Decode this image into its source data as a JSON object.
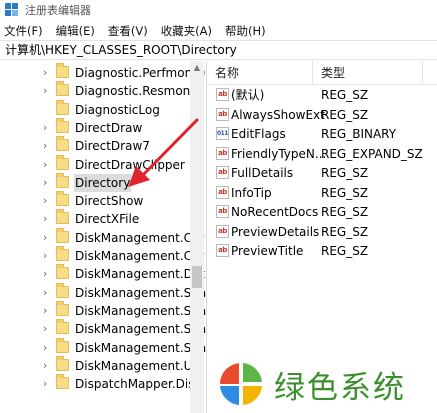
{
  "window": {
    "title": "注册表编辑器"
  },
  "menu": [
    "文件(F)",
    "编辑(E)",
    "查看(V)",
    "收藏夹(A)",
    "帮助(H)"
  ],
  "address": "计算机\\HKEY_CLASSES_ROOT\\Directory",
  "tree": {
    "items": [
      {
        "label": "Diagnostic.Perfmon.D",
        "expandable": true,
        "selected": false
      },
      {
        "label": "Diagnostic.Resmon.C",
        "expandable": true,
        "selected": false
      },
      {
        "label": "DiagnosticLog",
        "expandable": false,
        "selected": false
      },
      {
        "label": "DirectDraw",
        "expandable": true,
        "selected": false
      },
      {
        "label": "DirectDraw7",
        "expandable": true,
        "selected": false
      },
      {
        "label": "DirectDrawClipper",
        "expandable": true,
        "selected": false
      },
      {
        "label": "Directory",
        "expandable": true,
        "selected": true
      },
      {
        "label": "DirectShow",
        "expandable": true,
        "selected": false
      },
      {
        "label": "DirectXFile",
        "expandable": true,
        "selected": false
      },
      {
        "label": "DiskManagement.Cor",
        "expandable": true,
        "selected": false
      },
      {
        "label": "DiskManagement.Cor",
        "expandable": true,
        "selected": false
      },
      {
        "label": "DiskManagement.Dat",
        "expandable": true,
        "selected": false
      },
      {
        "label": "DiskManagement.Sna",
        "expandable": true,
        "selected": false
      },
      {
        "label": "DiskManagement.Sna",
        "expandable": true,
        "selected": false
      },
      {
        "label": "DiskManagement.Sna",
        "expandable": true,
        "selected": false
      },
      {
        "label": "DiskManagement.Sna",
        "expandable": true,
        "selected": false
      },
      {
        "label": "DiskManagement.UIT",
        "expandable": true,
        "selected": false
      },
      {
        "label": "DispatchMapper.Disp",
        "expandable": true,
        "selected": false
      }
    ]
  },
  "list": {
    "columns": {
      "name": "名称",
      "type": "类型"
    },
    "rows": [
      {
        "name": "(默认)",
        "type": "REG_SZ",
        "icon": "string-value-icon",
        "icon_text": "ab"
      },
      {
        "name": "AlwaysShowExt",
        "type": "REG_SZ",
        "icon": "string-value-icon",
        "icon_text": "ab"
      },
      {
        "name": "EditFlags",
        "type": "REG_BINARY",
        "icon": "binary-value-icon",
        "icon_text": "011"
      },
      {
        "name": "FriendlyTypeN...",
        "type": "REG_EXPAND_SZ",
        "icon": "string-value-icon",
        "icon_text": "ab"
      },
      {
        "name": "FullDetails",
        "type": "REG_SZ",
        "icon": "string-value-icon",
        "icon_text": "ab"
      },
      {
        "name": "InfoTip",
        "type": "REG_SZ",
        "icon": "string-value-icon",
        "icon_text": "ab"
      },
      {
        "name": "NoRecentDocs",
        "type": "REG_SZ",
        "icon": "string-value-icon",
        "icon_text": "ab"
      },
      {
        "name": "PreviewDetails",
        "type": "REG_SZ",
        "icon": "string-value-icon",
        "icon_text": "ab"
      },
      {
        "name": "PreviewTitle",
        "type": "REG_SZ",
        "icon": "string-value-icon",
        "icon_text": "ab"
      }
    ]
  },
  "watermark": {
    "text": "绿色系统"
  },
  "colors": {
    "annotation_arrow": "#e0242f",
    "folder": "#f9dc87",
    "watermark_text": "#3d8f2d",
    "selection": "#dcdcdc"
  }
}
